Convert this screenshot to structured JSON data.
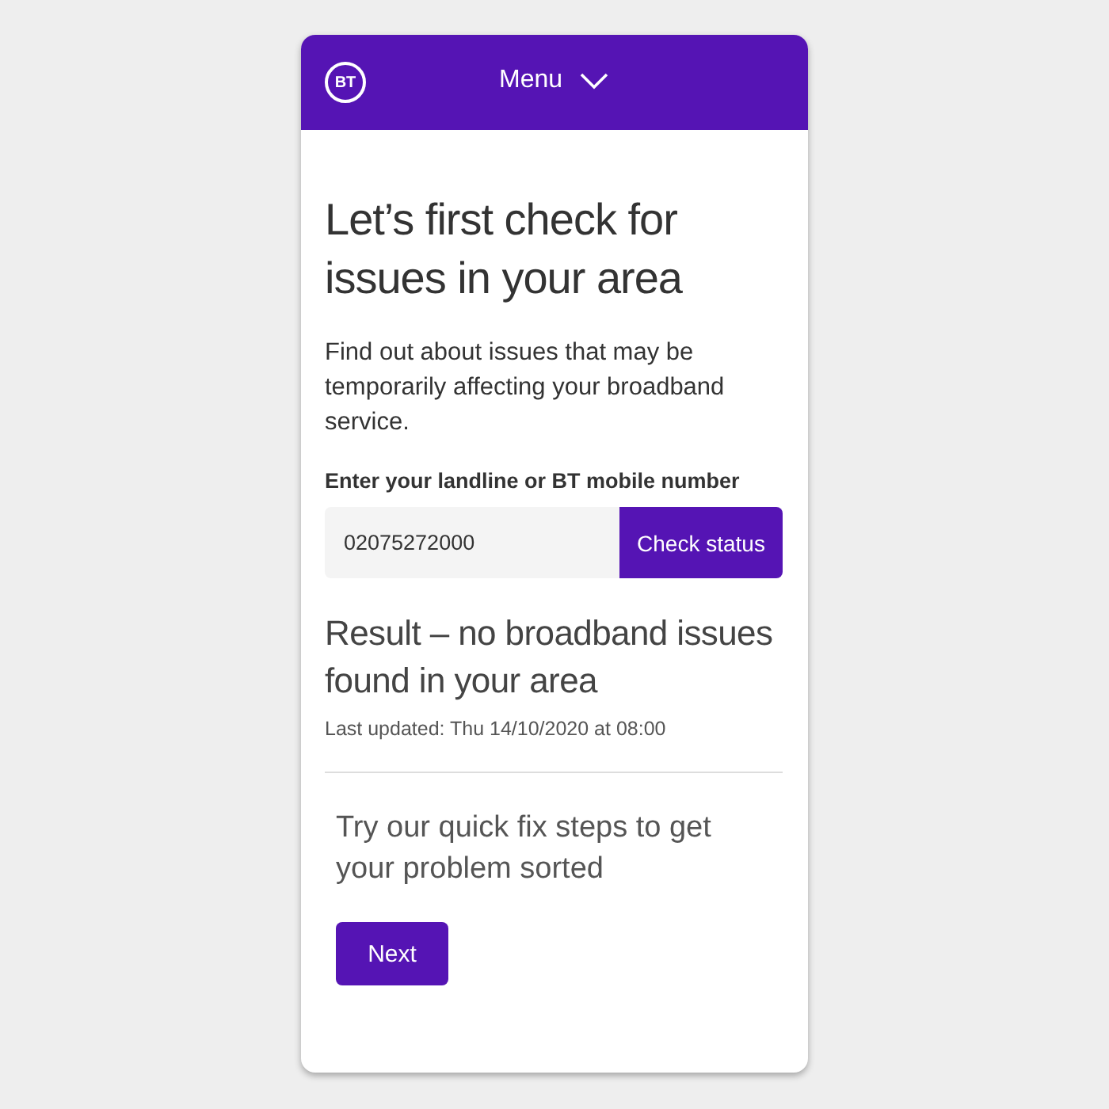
{
  "header": {
    "logo": "BT",
    "menu": "Menu"
  },
  "title": "Let’s first check for issues in your area",
  "intro": "Find out about issues that may be temporarily affecting your broadband service.",
  "form": {
    "label": "Enter your landline or BT mobile number",
    "value": "02075272000",
    "button": "Check status"
  },
  "result": {
    "title": "Result – no broadband issues found in your area",
    "updated": "Last updated: Thu 14/10/2020 at 08:00"
  },
  "next": {
    "text": "Try our quick fix steps to get your problem sorted",
    "button": "Next"
  }
}
